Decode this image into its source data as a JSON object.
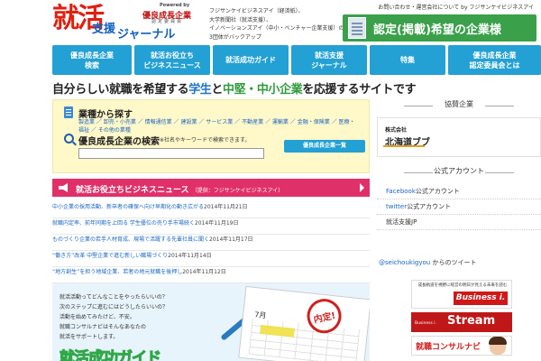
{
  "header": {
    "logo_main": "就活",
    "logo_sub1": "支援",
    "logo_sub2": "ジャーナル",
    "powered_by": "Powered by",
    "committee_name": "優良成長企業",
    "committee_sub": "認定委員会",
    "intro_lines": [
      "フジサンケイビジネスアイ（経済紙）、",
      "大学新聞社（就活支援）、",
      "イノベーションズアイ（中小・ベンチャー企業支援）の",
      "3団体がバックアップ"
    ],
    "top_links": "お問い合わせ・運営会社について by フジサンケイビジネスアイ",
    "cert_banner": "認定(掲載)希望の企業様",
    "accent_red": "#e02010",
    "accent_blue": "#1060c0"
  },
  "nav": {
    "items": [
      {
        "line1": "優良成長企業",
        "line2": "検索"
      },
      {
        "line1": "就活お役立ち",
        "line2": "ビジネスニュース"
      },
      {
        "line1": "就活成功ガイド",
        "line2": ""
      },
      {
        "line1": "就活支援",
        "line2": "ジャーナル"
      },
      {
        "line1": "特集",
        "line2": ""
      },
      {
        "line1": "優良成長企業",
        "line2": "認定委員会とは"
      }
    ],
    "color": "#23a0d4"
  },
  "tagline": {
    "part1": "自分らしい就職を希望する",
    "part2": "学生",
    "part3": "と",
    "part4": "中堅・中小企業",
    "part5": "を応援するサイトです"
  },
  "search": {
    "industry_title": "業種から探す",
    "industry_text": "製造業 ／ 卸売・小売業 ／ 情報通信業 ／ 建設業 ／ サービス業 ／ 不動産業 ／ 運輸業 ／ 金融・保険業 ／ 医療・福祉 ／ その他の業種",
    "company_title": "優良成長企業の検索",
    "company_note": "※社名やキーワードで検索できます。",
    "input_value": "",
    "list_button": "優良成長企業一覧"
  },
  "news": {
    "header": "就活お役立ちビジネスニュース",
    "header_source": "（提供：フジサンケイビジネスアイ）",
    "items": [
      {
        "text": "中小企業の採用活動、新卒者の確保へ向け早期化の動き広がる",
        "date": "2014年11月21日"
      },
      {
        "text": "就職内定率、前年同期を上回る 学生優位の売り手市場続く",
        "date": "2014年11月19日"
      },
      {
        "text": "ものづくり企業の若手人材育成、現場で活躍する先輩社員に聞く",
        "date": "2014年11月17日"
      },
      {
        "text": "“働き方”改革 中堅企業で進む新しい職場づくり",
        "date": "2014年11月14日"
      },
      {
        "text": "“地方創生”を担う地域企業、若者の地元就職を後押し",
        "date": "2014年11月12日"
      }
    ]
  },
  "guide": {
    "lines": [
      "就活活動ってどんなことをやったらいいの？",
      "次のステップに進むにはどうしたらいいの？",
      "活動を始めてみたけど、不安。",
      "就職コンサルナビはそんなあなたの",
      "就活をサポートします。"
    ],
    "title": "就活成功ガイド",
    "month": "7月",
    "stamp": "内定!"
  },
  "sidebar": {
    "partner_heading": "協賛企業",
    "partner_kaisha": "株式会社",
    "partner_name": "北海道ブブ",
    "official_heading": "公式アカウント",
    "official_items": [
      {
        "link": "Facebook",
        "rest": "公式アカウント"
      },
      {
        "link": "twitter",
        "rest": "公式アカウント"
      },
      {
        "link": "",
        "rest": "就活支援JP"
      }
    ],
    "twitter_handle": "@seichoukigyou",
    "twitter_rest": " からのツイート",
    "ad1_top": "成長軌道を視野に経営の明日が見える未来を読む",
    "ad1_brand": "Business i.",
    "ad2_small": "Business i.",
    "ad2_brand": "Stream",
    "ad3_brand": "就職コンサルナビ"
  }
}
